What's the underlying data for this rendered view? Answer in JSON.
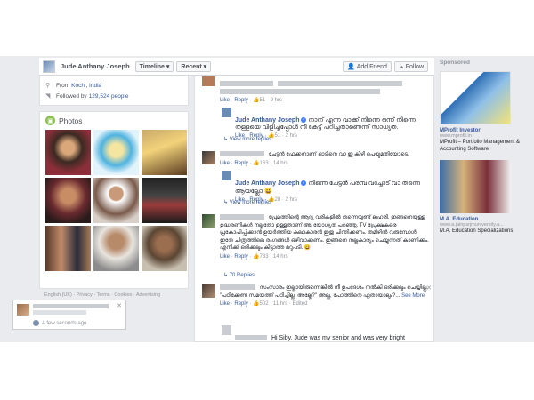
{
  "topbar": {
    "name": "Jude Anthany Joseph",
    "timeline": "Timeline ▾",
    "recent": "Recent ▾",
    "add_friend": "Add Friend",
    "follow": "Follow"
  },
  "about": {
    "from_label": "From",
    "from_value": "Kochi, India",
    "followed_label": "Followed by",
    "followed_value": "129,524 people"
  },
  "photos": {
    "title": "Photos"
  },
  "footer": {
    "links": "English (UK) · Privacy · Terms · Cookies · Advertising"
  },
  "notification": {
    "time": "A few seconds ago"
  },
  "feed": {
    "top_actions": {
      "like": "Like",
      "reply": "Reply",
      "count": "51",
      "age": "9 hrs"
    },
    "r1": {
      "name": "Jude Anthany Joseph",
      "text": "നാന് എന്ന വാക്ക് നിന്നെ ഒന്ന് നിന്നെ തള്ളയെ വിളിച്ചപ്പോൾ നീ കേട്ട് പഠിച്ചതാണെന്ന് സാധ്യത.",
      "like": "Like",
      "reply": "Reply",
      "count": "51",
      "age": "2 hrs"
    },
    "view_more_1": "View more replies",
    "c2": {
      "text": "ചേട്ടൻ ഫേക്കനാണ് ഓടിനെ വാ ഇ കിഴി പെയ്യുമതിയോടെ.",
      "like": "Like",
      "reply": "Reply",
      "count": "163",
      "age": "14 hrs"
    },
    "r2": {
      "name": "Jude Anthany Joseph",
      "text": "നിന്നെ ചേട്ടൻ പരമ്പ വച്ചോട് വാ തന്നെ ആയല്ലോ",
      "like": "Like",
      "reply": "Reply",
      "count": "28",
      "age": "2 hrs"
    },
    "view_more_2": "View more replies",
    "c3": {
      "text": "പ്രേമത്തിന്റെ ആദ്യ വരികളിൽ തന്നെയുണ്ട് ലഹരി. ഇങ്ങനെയുള്ള ഉദ്ധരണികൾ നല്ലതോ ഉള്ളതാണ് ആ യോഗ്യത പറഞ്ഞു. TV പ്രേക്ഷകരെ പ്രകോപിപ്പിക്കാൻ ഉയർത്തിയ കലാകാരൻ ഇതു ചിന്തിക്കണം. തമിഴിൽ വരുമ്പോൾ ഇതേ ചിത്രത്തിലെ രംഗങ്ങൾ ഒഴിവാക്കണം. ഇങ്ങനെ നല്ലകാര്യം ചെയ്യുന്നത് കാണിക്കും. എനിക്ക് ഒരിക്കലും കിട്ടാത്ത മറുപടി. 😀",
      "like": "Like",
      "reply": "Reply",
      "count": "733",
      "age": "14 hrs"
    },
    "replies_70": "70 Replies",
    "c4": {
      "text": "സംസാരം ഇല്ലായിരുന്നെങ്കിൽ നീ ഉപദേശം നൽകി ഒരിക്കലും ചെയ്യില്ല. \"പഠിക്കേണ്ട സമയത്ത് പഠിച്ചില്ല, അല്ലേ?\" അല്ല, പോത്തിനെ ഏതായാലും?...",
      "see_more": "See More",
      "like": "Like",
      "reply": "Reply",
      "count": "502",
      "age": "11 hrs",
      "edited": "Edited"
    },
    "r4": {
      "text": "Hi Siby, Jude was my senior and was very bright student. Your story might be true. But I dont agree with what he said."
    }
  },
  "ads": {
    "sponsored": "Sponsored",
    "ad1": {
      "title": "MProfit Investor",
      "url": "www.mprofit.in",
      "desc": "MProfit – Portfolio Management & Accounting Software"
    },
    "ad2": {
      "title": "M.A. Education",
      "url": "www.a.jainpsrjmuniversity.a...",
      "desc": "M.A. Education Specializations"
    }
  },
  "colors": {
    "link": "#365899",
    "bg": "#e9ebee",
    "muted": "#90949c"
  }
}
